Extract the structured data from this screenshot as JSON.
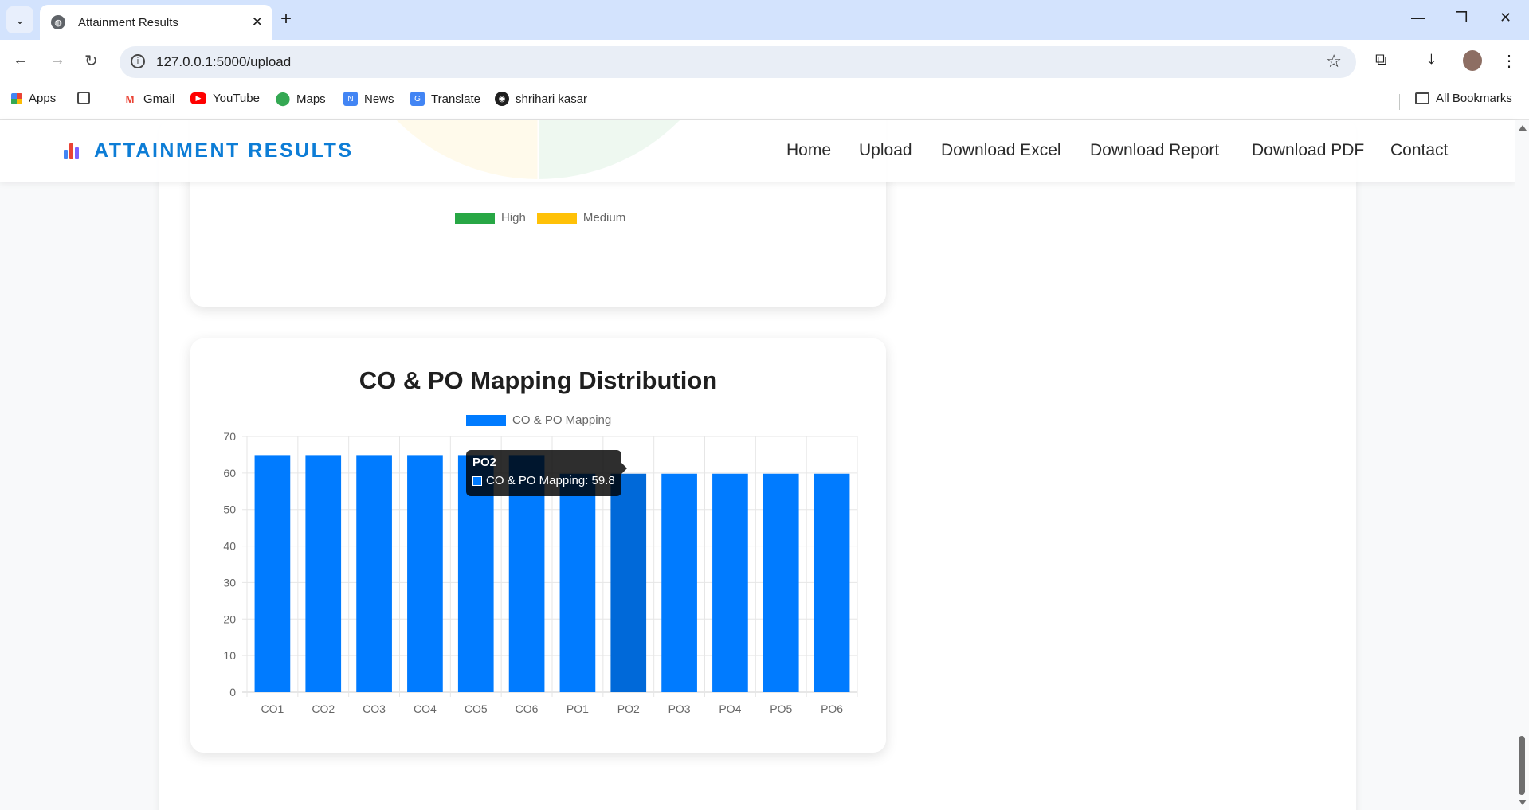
{
  "browser": {
    "tab_title": "Attainment Results",
    "url": "127.0.0.1:5000/upload",
    "bookmarks": [
      {
        "label": "Apps",
        "icon": "apps-grid-icon"
      },
      {
        "label": "",
        "icon": "grid-icon"
      },
      {
        "label": "Gmail",
        "icon": "gmail-icon"
      },
      {
        "label": "YouTube",
        "icon": "youtube-icon"
      },
      {
        "label": "Maps",
        "icon": "maps-icon"
      },
      {
        "label": "News",
        "icon": "news-icon"
      },
      {
        "label": "Translate",
        "icon": "translate-icon"
      },
      {
        "label": "shrihari kasar",
        "icon": "github-icon"
      }
    ],
    "all_bookmarks": "All Bookmarks"
  },
  "header": {
    "brand": "ATTAINMENT RESULTS",
    "nav": [
      "Home",
      "Upload",
      "Download Excel",
      "Download Report",
      "Download PDF",
      "Contact"
    ]
  },
  "pie_legend": [
    {
      "label": "High",
      "color": "#28a745"
    },
    {
      "label": "Medium",
      "color": "#ffc107"
    }
  ],
  "colors": {
    "bar": "#007bff",
    "bar_hover": "#0069d9",
    "high": "#28a745",
    "medium": "#ffc107",
    "brand": "#0d7dd6"
  },
  "chart_data": {
    "type": "bar",
    "title": "CO & PO Mapping Distribution",
    "categories": [
      "CO1",
      "CO2",
      "CO3",
      "CO4",
      "CO5",
      "CO6",
      "PO1",
      "PO2",
      "PO3",
      "PO4",
      "PO5",
      "PO6"
    ],
    "series": [
      {
        "name": "CO & PO Mapping",
        "values": [
          64.9,
          64.9,
          64.9,
          64.9,
          64.9,
          64.9,
          59.8,
          59.8,
          59.8,
          59.8,
          59.8,
          59.8
        ]
      }
    ],
    "ylim": [
      0,
      70
    ],
    "yticks": [
      0,
      10,
      20,
      30,
      40,
      50,
      60,
      70
    ],
    "grid": true,
    "legend": "top-center",
    "hovered_index": 7,
    "tooltip": {
      "title": "PO2",
      "label": "CO & PO Mapping: 59.8"
    }
  }
}
